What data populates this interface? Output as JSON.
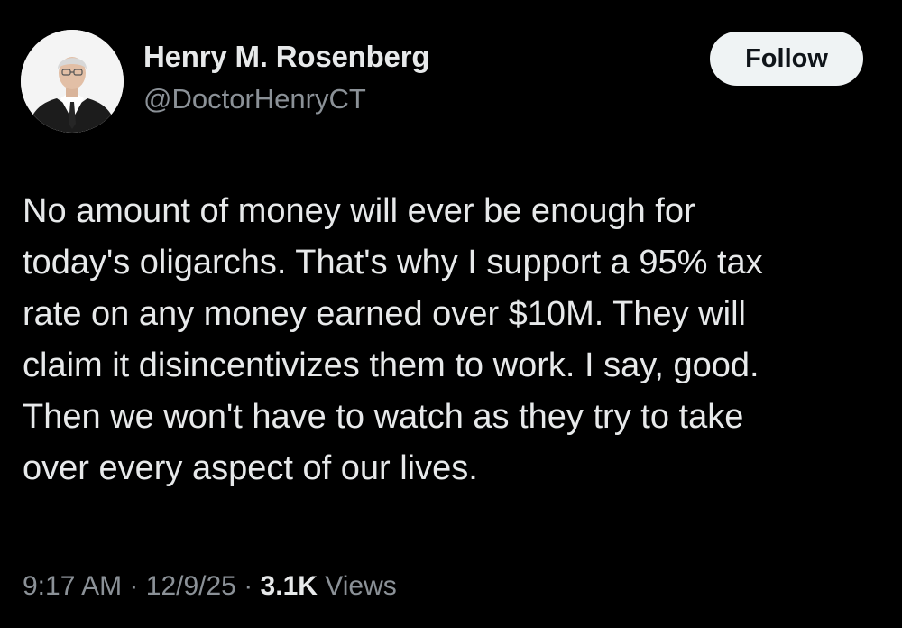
{
  "author": {
    "name": "Henry M. Rosenberg",
    "handle": "@DoctorHenryCT",
    "avatar_icon": "profile-photo"
  },
  "follow_button": {
    "label": "Follow"
  },
  "tweet": {
    "lines": [
      "No amount of money will ever be enough for",
      "today's oligarchs. That's why I support a 95% tax",
      "rate on any money earned over $10M. They will",
      "claim it disincentivizes them to work. I say, good.",
      "Then we won't have to watch as they try to take",
      "over every aspect of our lives."
    ]
  },
  "meta": {
    "time": "9:17 AM",
    "separator": "·",
    "date": "12/9/25",
    "views_count": "3.1K",
    "views_label": "Views"
  },
  "colors": {
    "background": "#000000",
    "primary_text": "#e7e9ea",
    "secondary_text": "#8b9197",
    "follow_bg": "#eff3f4",
    "follow_text": "#0f1419"
  }
}
